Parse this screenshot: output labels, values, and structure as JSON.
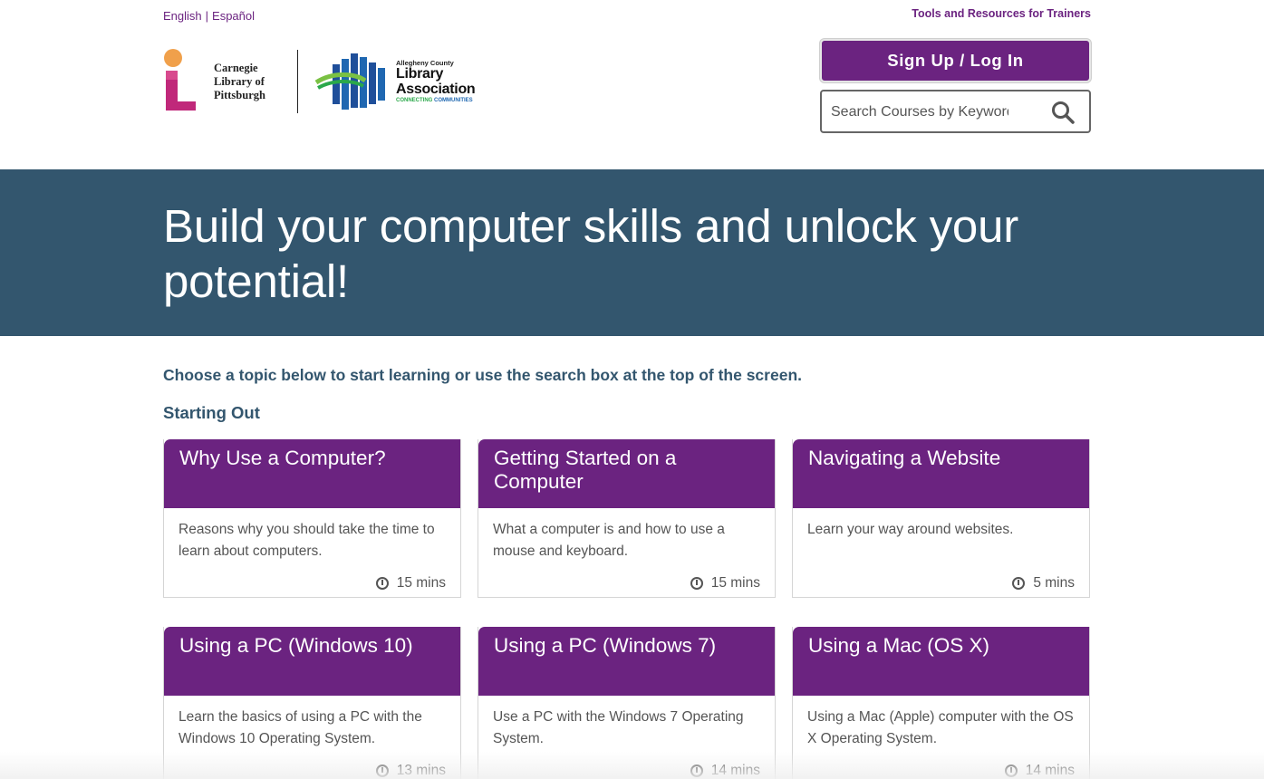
{
  "header": {
    "languages": [
      "English",
      "Español"
    ],
    "trainers_link": "Tools and Resources for Trainers",
    "logos": {
      "clp": "Carnegie Library of Pittsburgh",
      "clp_lines": [
        "Carnegie",
        "Library of",
        "Pittsburgh"
      ],
      "acla_small": "Allegheny County",
      "acla_line1": "Library",
      "acla_line2": "Association",
      "acla_tag_1": "CONNECTING",
      "acla_tag_2": "COMMUNITIES"
    },
    "signup_label": "Sign Up / Log In",
    "search_placeholder": "Search Courses by Keyword",
    "icon": "search-icon"
  },
  "hero": {
    "title": "Build your computer skills and unlock your potential!"
  },
  "main": {
    "intro": "Choose a topic below to start learning or use the search box at the top of the screen.",
    "section_title": "Starting Out",
    "cards": [
      {
        "title": "Why Use a Computer?",
        "description": "Reasons why you should take the time to learn about computers.",
        "duration": "15 mins"
      },
      {
        "title": "Getting Started on a Computer",
        "description": "What a computer is and how to use a mouse and keyboard.",
        "duration": "15 mins"
      },
      {
        "title": "Navigating a Website",
        "description": "Learn your way around websites.",
        "duration": "5 mins"
      },
      {
        "title": "Using a PC (Windows 10)",
        "description": "Learn the basics of using a PC with the Windows 10 Operating System.",
        "duration": "13 mins"
      },
      {
        "title": "Using a PC (Windows 7)",
        "description": "Use a PC with the Windows 7 Operating System.",
        "duration": "14 mins"
      },
      {
        "title": "Using a Mac (OS X)",
        "description": "Using a Mac (Apple) computer with the OS X Operating System.",
        "duration": "14 mins"
      }
    ]
  },
  "colors": {
    "brand_purple": "#6b2380",
    "hero_blue": "#33566e",
    "heading_blue": "#33566e"
  }
}
